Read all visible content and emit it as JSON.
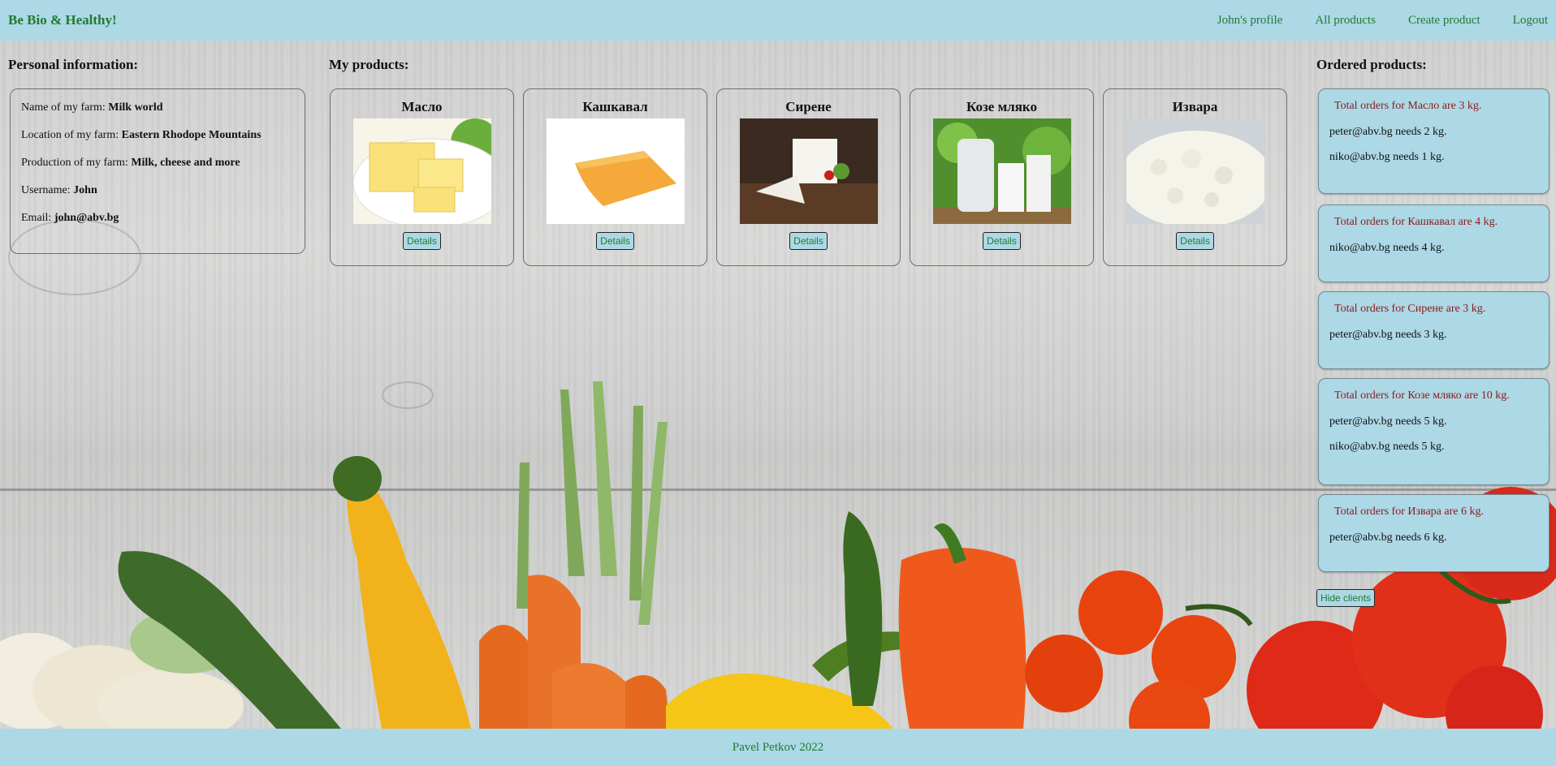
{
  "nav": {
    "brand": "Be Bio & Healthy!",
    "links": [
      "John's profile",
      "All products",
      "Create product",
      "Logout"
    ]
  },
  "sections": {
    "personal_title": "Personal information:",
    "products_title": "My products:",
    "orders_title": "Ordered products:"
  },
  "personal": {
    "farm_name_label": "Name of my farm: ",
    "farm_name": "Milk world",
    "location_label": "Location of my farm: ",
    "location": "Eastern Rhodope Mountains",
    "production_label": "Production of my farm: ",
    "production": "Milk, cheese and more",
    "username_label": "Username: ",
    "username": "John",
    "email_label": "Email: ",
    "email": "john@abv.bg"
  },
  "products": [
    {
      "name": "Масло",
      "button": "Details",
      "image": "butter-image"
    },
    {
      "name": "Кашкавал",
      "button": "Details",
      "image": "yellow-cheese-image"
    },
    {
      "name": "Сирене",
      "button": "Details",
      "image": "white-cheese-image"
    },
    {
      "name": "Козе мляко",
      "button": "Details",
      "image": "goat-milk-image"
    },
    {
      "name": "Извара",
      "button": "Details",
      "image": "cottage-cheese-image"
    }
  ],
  "orders": [
    {
      "total": "Total orders for Масло are 3 kg.",
      "clients": [
        "peter@abv.bg needs 2 kg.",
        "niko@abv.bg needs 1 kg."
      ]
    },
    {
      "total": "Total orders for Кашкавал are 4 kg.",
      "clients": [
        "niko@abv.bg needs 4 kg."
      ]
    },
    {
      "total": "Total orders for Сирене are 3 kg.",
      "clients": [
        "peter@abv.bg needs 3 kg."
      ]
    },
    {
      "total": "Total orders for Козе мляко are 10 kg.",
      "clients": [
        "peter@abv.bg needs 5 kg.",
        "niko@abv.bg needs 5 kg."
      ]
    },
    {
      "total": "Total orders for Извара are 6 kg.",
      "clients": [
        "peter@abv.bg needs 6 kg."
      ]
    }
  ],
  "hide_clients_label": "Hide clients",
  "footer": {
    "text": "Pavel Petkov 2022"
  },
  "colors": {
    "header_bg": "#add8e6",
    "link_green": "#1e7b2e",
    "order_total_red": "#8b1a1a"
  }
}
